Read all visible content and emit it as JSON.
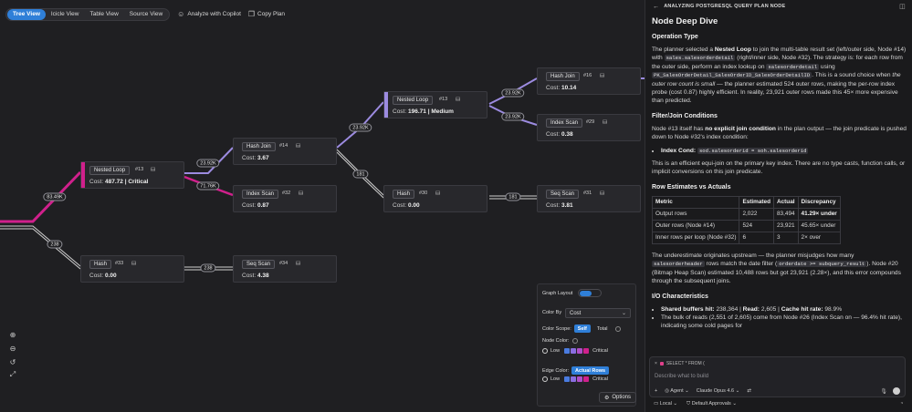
{
  "toolbar": {
    "views": [
      "Tree View",
      "Icicle View",
      "Table View",
      "Source View"
    ],
    "active_view": "Tree View",
    "analyze_label": "Analyze with Copilot",
    "copy_label": "Copy Plan"
  },
  "nodes": [
    {
      "op": "Nested Loop",
      "id": "#13",
      "cost": "487.72",
      "tag": "Critical",
      "color": "#d0208c"
    },
    {
      "op": "Hash",
      "id": "#33",
      "cost": "0.00",
      "tag": "",
      "color": ""
    },
    {
      "op": "Hash Join",
      "id": "#14",
      "cost": "3.67",
      "tag": "",
      "color": ""
    },
    {
      "op": "Index Scan",
      "id": "#32",
      "cost": "0.87",
      "tag": "",
      "color": ""
    },
    {
      "op": "Seq Scan",
      "id": "#34",
      "cost": "4.38",
      "tag": "",
      "color": ""
    },
    {
      "op": "Nested Loop",
      "id": "#13",
      "cost": "196.71",
      "tag": "Medium",
      "color": "#9c8be0"
    },
    {
      "op": "Hash",
      "id": "#30",
      "cost": "0.00",
      "tag": "",
      "color": ""
    },
    {
      "op": "Hash Join",
      "id": "#16",
      "cost": "10.14",
      "tag": "",
      "color": ""
    },
    {
      "op": "Index Scan",
      "id": "#29",
      "cost": "0.38",
      "tag": "",
      "color": ""
    },
    {
      "op": "Seq Scan",
      "id": "#31",
      "cost": "3.81",
      "tag": "",
      "color": ""
    }
  ],
  "edge_labels": [
    "83.49K",
    "238",
    "23.92K",
    "71.76K",
    "238",
    "23.92K",
    "181",
    "23.92K",
    "23.92K",
    "181"
  ],
  "cost_label": "Cost:",
  "graph_options": {
    "layout_label": "Graph Layout",
    "color_by_label": "Color By",
    "color_by_value": "Cost",
    "color_scope_label": "Color Scope:",
    "scope_self": "Self",
    "scope_total": "Total",
    "node_color_label": "Node Color:",
    "edge_color_label": "Edge Color:",
    "edge_color_value": "Actual Rows",
    "low_label": "Low",
    "critical_label": "Critical",
    "scale_colors": [
      "#4a7be0",
      "#8a6ee0",
      "#b04ec8",
      "#d0208c"
    ],
    "options_label": "Options"
  },
  "panel": {
    "header": "ANALYZING POSTGRESQL QUERY PLAN NODE",
    "title": "Node Deep Dive",
    "op_type_heading": "Operation Type",
    "filter_heading": "Filter/Join Conditions",
    "row_est_heading": "Row Estimates vs Actuals",
    "io_heading": "I/O Characteristics",
    "p1_a": "The planner selected a ",
    "p1_b": "Nested Loop",
    "p1_c": " to join the multi-table result set (left/outer side, Node #14) with ",
    "p1_d": "sales.salesorderdetail",
    "p1_e": " (right/inner side, Node #32). The strategy is: for each row from the outer side, perform an index lookup on ",
    "p1_f": "salesorderdetail",
    "p1_g": " using ",
    "p1_h": "PK_SalesOrderDetail_SalesOrderID_SalesOrderDetailID",
    "p1_i": ". This is a sound choice when ",
    "p1_j": "the outer row count is small",
    "p1_k": " — the planner estimated 524 outer rows, making the per-row index probe (cost 0.87) highly efficient. In reality, 23,921 outer rows made this 45× more expensive than predicted.",
    "p2_a": "Node #13 itself has ",
    "p2_b": "no explicit join condition",
    "p2_c": " in the plan output — the join predicate is pushed down to Node #32's index condition:",
    "cond_label": "Index Cond:",
    "cond_code": "sod.salesorderid = soh.salesorderid",
    "p3": "This is an efficient equi-join on the primary key index. There are no type casts, function calls, or implicit conversions on this join predicate.",
    "table_headers": [
      "Metric",
      "Estimated",
      "Actual",
      "Discrepancy"
    ],
    "table_rows": [
      [
        "Output rows",
        "2,022",
        "83,494",
        "41.29× under"
      ],
      [
        "Outer rows (Node #14)",
        "524",
        "23,921",
        "45.65× under"
      ],
      [
        "Inner rows per loop (Node #32)",
        "6",
        "3",
        "2× over"
      ]
    ],
    "p4_a": "The underestimate originates upstream — the planner misjudges how many ",
    "p4_b": "salesorderheader",
    "p4_c": " rows match the date filter (",
    "p4_d": "orderdate >= subquery_result",
    "p4_e": "). Node #20 (Bitmap Heap Scan) estimated 10,488 rows but got 23,921 (2.28×), and this error compounds through the subsequent joins.",
    "io1_a": "Shared buffers hit:",
    "io1_b": " 238,364 | ",
    "io1_c": "Read:",
    "io1_d": " 2,605 | ",
    "io1_e": "Cache hit rate:",
    "io1_f": " 98.9%",
    "io2": "The bulk of reads (2,551 of 2,605) come from Node #26 (Index Scan on",
    "io3": "— 96.4% hit rate), indicating some cold pages for"
  },
  "chat": {
    "context": "SELECT * FROM (",
    "placeholder": "Describe what to build",
    "agent_label": "Agent",
    "model_label": "Claude Opus 4.6"
  },
  "status": {
    "local": "Local",
    "approvals": "Default Approvals"
  }
}
